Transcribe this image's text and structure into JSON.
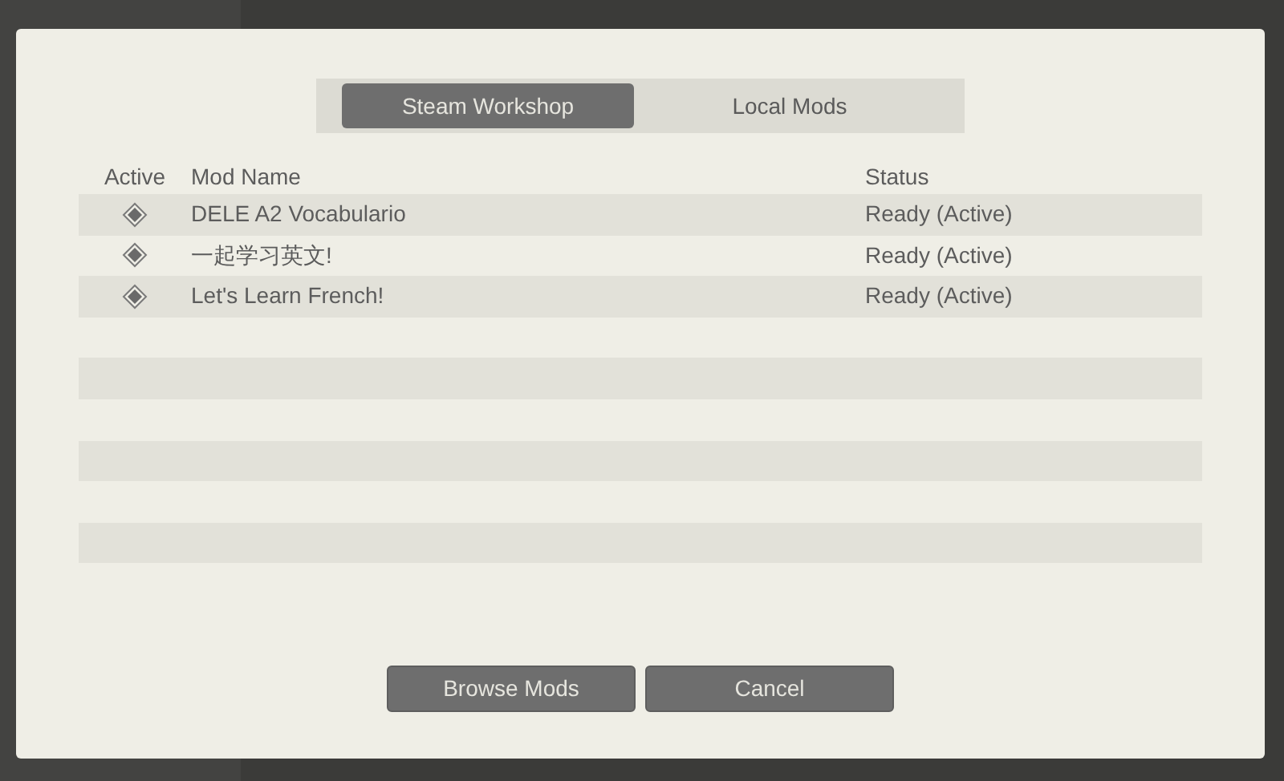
{
  "tabs": [
    {
      "label": "Steam Workshop",
      "selected": true
    },
    {
      "label": "Local Mods",
      "selected": false
    }
  ],
  "table": {
    "columns": [
      "Active",
      "Mod Name",
      "Status"
    ],
    "rows": [
      {
        "active": true,
        "name": "DELE A2 Vocabulario",
        "status": "Ready (Active)"
      },
      {
        "active": true,
        "name": "一起学习英文!",
        "status": "Ready (Active)"
      },
      {
        "active": true,
        "name": "Let's Learn French!",
        "status": "Ready (Active)"
      }
    ]
  },
  "buttons": [
    "Browse Mods",
    "Cancel"
  ]
}
